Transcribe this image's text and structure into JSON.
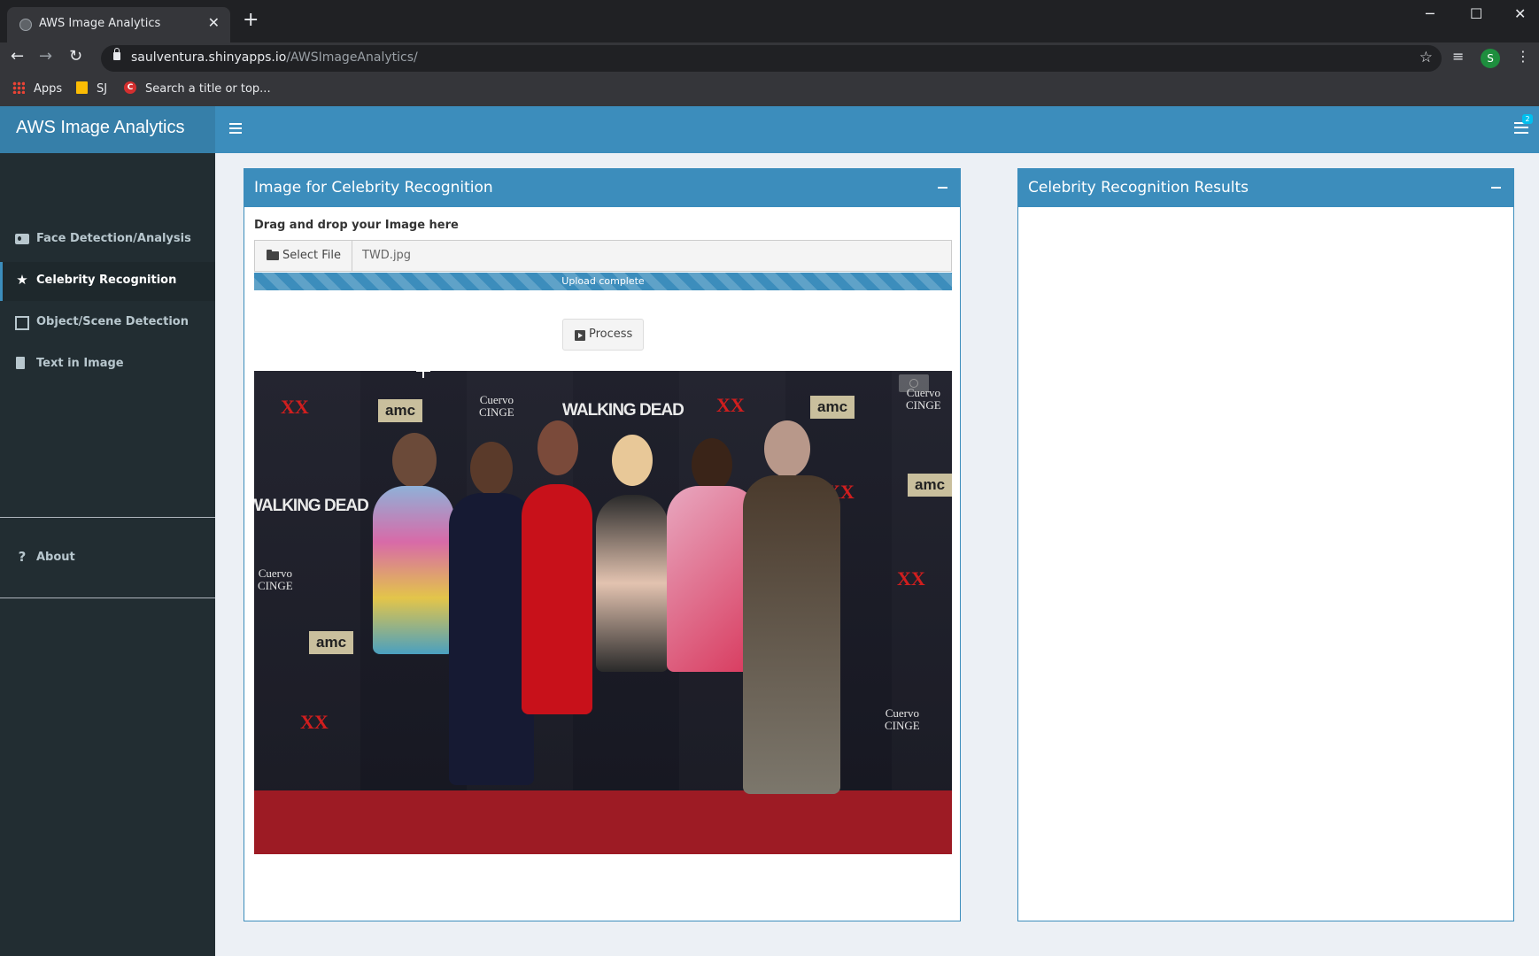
{
  "browser": {
    "tab_title": "AWS Image Analytics",
    "url_host": "saulventura.shinyapps.io",
    "url_path": "/AWSImageAnalytics/",
    "avatar_letter": "S",
    "bookmarks": [
      "Apps",
      "SJ",
      "Search a title or top..."
    ]
  },
  "app": {
    "title": "AWS Image Analytics",
    "tasks_badge": "2"
  },
  "sidebar": {
    "items": [
      {
        "label": "Face Detection/Analysis",
        "icon": "id-card-icon",
        "active": false
      },
      {
        "label": "Celebrity Recognition",
        "icon": "star-icon",
        "active": true
      },
      {
        "label": "Object/Scene Detection",
        "icon": "object-group-icon",
        "active": false
      },
      {
        "label": "Text in Image",
        "icon": "file-text-icon",
        "active": false
      }
    ],
    "about_label": "About",
    "about_icon": "question-icon"
  },
  "input_box": {
    "title": "Image for Celebrity Recognition",
    "drag_label": "Drag and drop your Image here",
    "select_button": "Select File",
    "filename": "TWD.jpg",
    "progress_text": "Upload complete",
    "progress_percent": 100,
    "process_button": "Process"
  },
  "results_box": {
    "title": "Celebrity Recognition Results"
  },
  "colors": {
    "header_blue": "#3c8dbc",
    "logo_blue": "#367fa9",
    "sidebar_bg": "#222d32",
    "content_bg": "#ecf0f5"
  },
  "photo": {
    "amc": "amc",
    "xx": "XX",
    "walking_dead": "WALKING DEAD",
    "cuervo": "Cuervo",
    "cuervo_sub": "CINGE"
  }
}
